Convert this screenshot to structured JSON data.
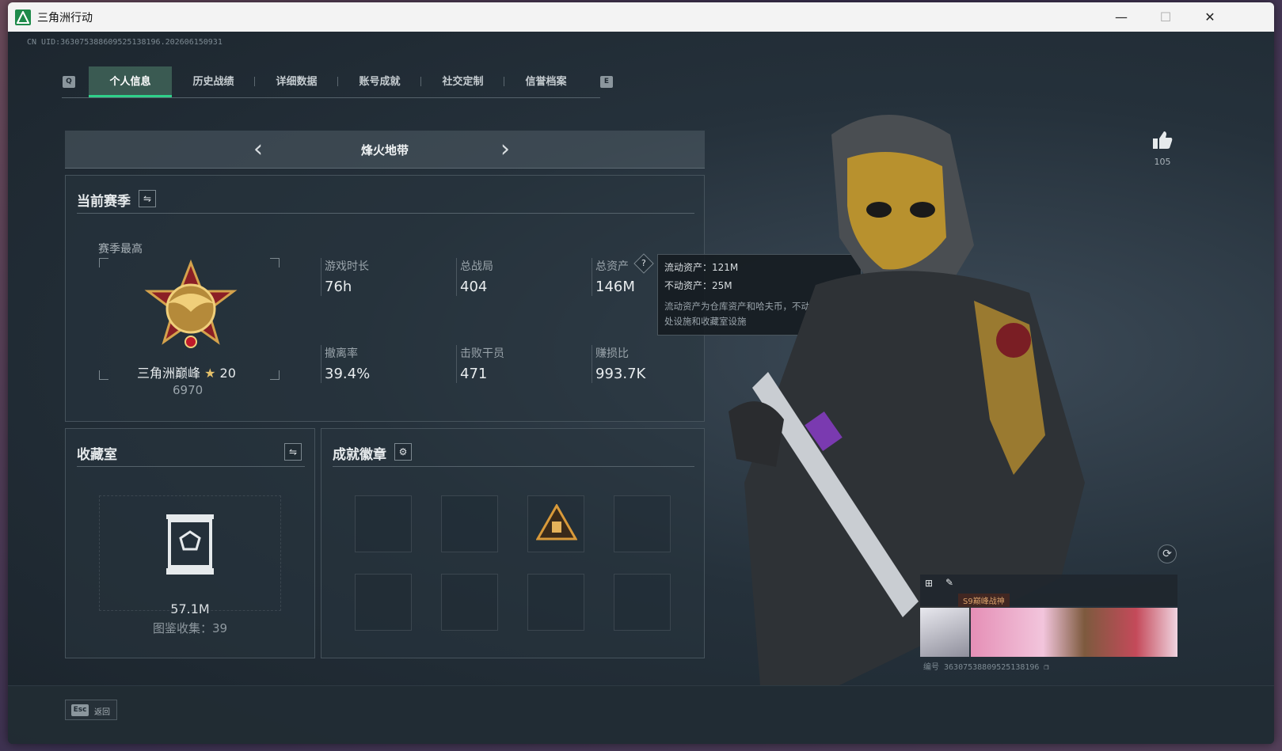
{
  "window": {
    "title": "三角洲行动",
    "minimize": "—",
    "maximize": "☐",
    "close": "✕"
  },
  "uid": "CN UID:3630753886095251381​96.202606150931",
  "tabs": {
    "prev_key": "Q",
    "next_key": "E",
    "items": [
      {
        "label": "个人信息",
        "active": true
      },
      {
        "label": "历史战绩",
        "active": false
      },
      {
        "label": "详细数据",
        "active": false
      },
      {
        "label": "账号成就",
        "active": false
      },
      {
        "label": "社交定制",
        "active": false
      },
      {
        "label": "信誉档案",
        "active": false
      }
    ]
  },
  "mode": {
    "title": "烽火地带",
    "prev": "‹",
    "next": "›"
  },
  "season": {
    "title": "当前赛季",
    "switch_icon": "⇋",
    "best_label": "赛季最高",
    "rank_name": "三角洲巅峰",
    "rank_stars": "20",
    "rank_score": "6970",
    "stats": [
      {
        "label": "游戏时长",
        "value": "76h"
      },
      {
        "label": "总战局",
        "value": "404"
      },
      {
        "label": "总资产",
        "value": "146M"
      },
      {
        "label": "撤离率",
        "value": "39.4%"
      },
      {
        "label": "击败干员",
        "value": "471"
      },
      {
        "label": "赚损比",
        "value": "993.7K"
      }
    ],
    "help_icon": "?"
  },
  "tooltip": {
    "liquid": "流动资产：121M",
    "fixed": "不动资产：25M",
    "desc": "流动资产为仓库资产和哈夫币，不动资产为特勤处设施和收藏室设施"
  },
  "collection": {
    "title": "收藏室",
    "switch_icon": "⇋",
    "value": "57.1M",
    "catalog": "图鉴收集：39"
  },
  "achievements": {
    "title": "成就徽章",
    "settings_icon": "⚙"
  },
  "like": {
    "count": "105"
  },
  "card": {
    "title": "S9巅峰战神",
    "id": "编号 3630​7538809525138196"
  },
  "bottom": {
    "esc_key": "Esc",
    "back_label": "返回"
  },
  "colors": {
    "accent": "#2fd08a",
    "panel_bg": "#28343e",
    "text": "#e8ecee"
  }
}
